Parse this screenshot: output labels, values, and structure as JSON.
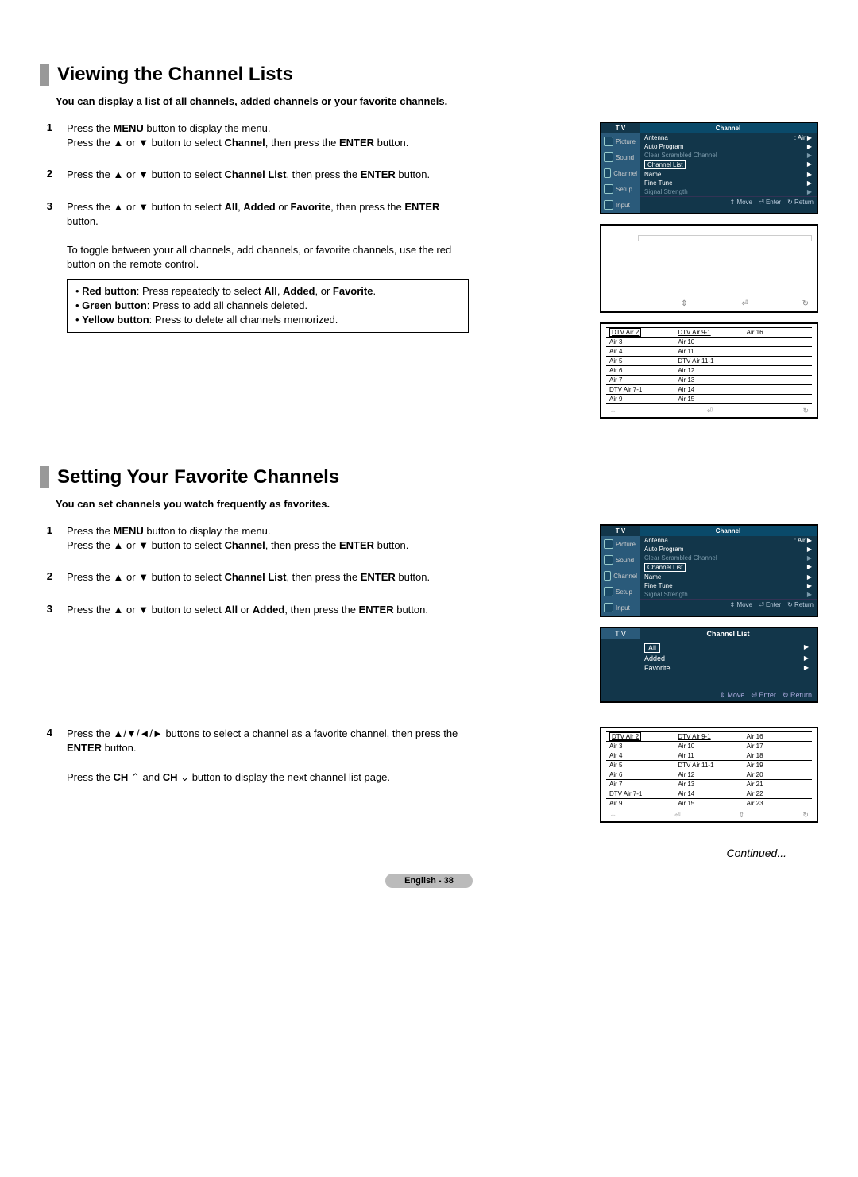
{
  "section1": {
    "title": "Viewing the Channel Lists",
    "intro": "You can display a list of all channels, added channels or your favorite channels.",
    "steps": [
      {
        "num": "1",
        "html": "Press the <b>MENU</b> button to display the menu.<br>Press the ▲ or ▼ button to select <b>Channel</b>, then press the <b>ENTER</b> button."
      },
      {
        "num": "2",
        "html": "Press the ▲ or ▼ button to select <b>Channel List</b>, then press the <b>ENTER</b> button."
      },
      {
        "num": "3",
        "html": "Press the ▲ or ▼ button to select <b>All</b>, <b>Added</b> or <b>Favorite</b>, then press the <b>ENTER</b> button.<br><br>To toggle between your all channels, add channels, or favorite channels, use the red button on the remote control."
      }
    ],
    "notes": [
      "• <b>Red button</b>: Press repeatedly to select <b>All</b>, <b>Added</b>, or <b>Favorite</b>.",
      "• <b>Green button</b>: Press to add all channels deleted.",
      "• <b>Yellow button</b>: Press to delete all channels memorized."
    ],
    "channel_grid": {
      "cols": [
        [
          "DTV Air 2",
          "Air 3",
          "Air 4",
          "Air 5",
          "Air 6",
          "Air 7",
          "DTV Air 7-1",
          "Air 9"
        ],
        [
          "DTV Air 9-1",
          "Air 10",
          "Air 11",
          "DTV Air 11-1",
          "Air 12",
          "Air 13",
          "Air 14",
          "Air 15"
        ],
        [
          "Air 16",
          "",
          "",
          "",
          "",
          "",
          "",
          ""
        ]
      ]
    }
  },
  "osd_menu": {
    "tv": "T V",
    "right_title": "Channel",
    "left_tabs": [
      "Picture",
      "Sound",
      "Channel",
      "Setup",
      "Input"
    ],
    "rows": [
      {
        "label": "Antenna",
        "value": ": Air"
      },
      {
        "label": "Auto Program",
        "value": ""
      },
      {
        "label": "Clear Scrambled Channel",
        "value": "",
        "dim": true
      },
      {
        "label": "Channel List",
        "value": "",
        "sel": true
      },
      {
        "label": "Name",
        "value": ""
      },
      {
        "label": "Fine Tune",
        "value": ""
      },
      {
        "label": "Signal Strength",
        "value": "",
        "dim": true
      }
    ],
    "footer": {
      "move": "Move",
      "enter": "Enter",
      "return": "Return"
    }
  },
  "list_menu": {
    "tv": "T V",
    "title": "Channel List",
    "items": [
      "All",
      "Added",
      "Favorite"
    ],
    "footer": {
      "move": "Move",
      "enter": "Enter",
      "return": "Return"
    }
  },
  "section2": {
    "title": "Setting Your Favorite Channels",
    "intro": "You can set channels you watch frequently as favorites.",
    "steps": [
      {
        "num": "1",
        "html": "Press the <b>MENU</b> button to display the menu.<br>Press the ▲ or ▼ button to select <b>Channel</b>, then press the <b>ENTER</b> button."
      },
      {
        "num": "2",
        "html": "Press the ▲ or ▼ button to select <b>Channel List</b>, then press the <b>ENTER</b> button."
      },
      {
        "num": "3",
        "html": "Press the ▲ or ▼ button to select <b>All</b> or <b>Added</b>, then press the <b>ENTER</b> button."
      },
      {
        "num": "4",
        "html": "Press the ▲/▼/◄/► buttons to select a channel as a favorite channel, then press the <b>ENTER</b> button.<br><br>Press the <b>CH</b> <span class='symbol'>⌃</span> and <b>CH</b> <span class='symbol'>⌄</span> button to display the next channel list page."
      }
    ],
    "channel_grid": {
      "cols": [
        [
          "DTV Air 2",
          "Air 3",
          "Air 4",
          "Air 5",
          "Air 6",
          "Air 7",
          "DTV Air 7-1",
          "Air 9"
        ],
        [
          "DTV Air 9-1",
          "Air 10",
          "Air 11",
          "DTV Air 11-1",
          "Air 12",
          "Air 13",
          "Air 14",
          "Air 15"
        ],
        [
          "Air 16",
          "Air 17",
          "Air 18",
          "Air 19",
          "Air 20",
          "Air 21",
          "Air 22",
          "Air 23"
        ]
      ]
    }
  },
  "continued": "Continued...",
  "page_label": "English - 38"
}
